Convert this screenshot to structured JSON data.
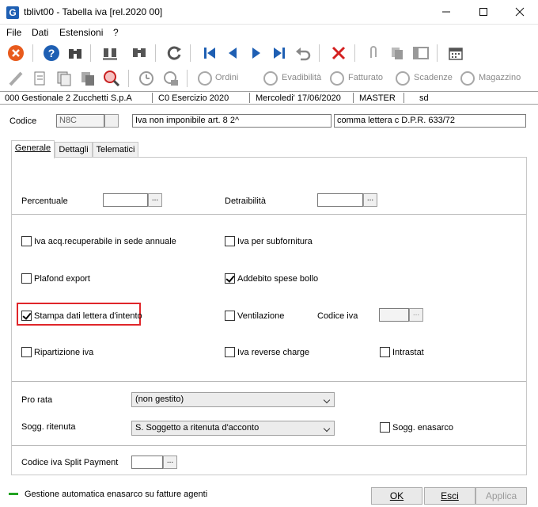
{
  "window": {
    "title": "tblivt00 - Tabella iva  [rel.2020 00]",
    "app_icon_letter": "G"
  },
  "menu": {
    "items": [
      "File",
      "Dati",
      "Estensioni",
      "?"
    ]
  },
  "toolbar2": {
    "ordini": "Ordini",
    "evadibilita": "Evadibilità",
    "fatturato": "Fatturato",
    "scadenze": "Scadenze",
    "magazzino": "Magazzino"
  },
  "infobar": {
    "company": "000 Gestionale 2 Zucchetti S.p.A",
    "exercise": "C0 Esercizio 2020",
    "date": "Mercoledi' 17/06/2020",
    "user": "MASTER",
    "extra": "sd"
  },
  "header": {
    "codice_label": "Codice",
    "codice_value": "N8C",
    "description": "Iva non imponibile art. 8 2^",
    "note": "comma lettera c D.P.R. 633/72"
  },
  "tabs": [
    "Generale",
    "Dettagli",
    "Telematici"
  ],
  "form": {
    "percentuale_label": "Percentuale",
    "detraibilita_label": "Detraibilità",
    "checkboxes": {
      "iva_acq": {
        "label": "Iva acq.recuperabile in sede annuale",
        "checked": false
      },
      "iva_sub": {
        "label": "Iva per subfornitura",
        "checked": false
      },
      "plafond": {
        "label": "Plafond export",
        "checked": false
      },
      "addebito": {
        "label": "Addebito spese bollo",
        "checked": true
      },
      "stampa": {
        "label": "Stampa dati lettera d'intento",
        "checked": true
      },
      "ventilazione": {
        "label": "Ventilazione",
        "checked": false
      },
      "ripartizione": {
        "label": "Ripartizione iva",
        "checked": false
      },
      "reverse": {
        "label": "Iva reverse charge",
        "checked": false
      },
      "intrastat": {
        "label": "Intrastat",
        "checked": false
      },
      "enasarco": {
        "label": "Sogg. enasarco",
        "checked": false
      }
    },
    "codice_iva_label": "Codice iva",
    "pro_rata_label": "Pro rata",
    "pro_rata_value": "(non gestito)",
    "sogg_ritenuta_label": "Sogg. ritenuta",
    "sogg_ritenuta_value": "S. Soggetto a ritenuta d'acconto",
    "split_label": "Codice iva Split Payment",
    "ellipsis": "..."
  },
  "status": {
    "message": "Gestione automatica enasarco su fatture agenti"
  },
  "buttons": {
    "ok": "OK",
    "esci": "Esci",
    "applica": "Applica"
  },
  "colors": {
    "accent_blue": "#1e5fb3",
    "highlight_red": "#e0262a",
    "status_green": "#22a322"
  }
}
